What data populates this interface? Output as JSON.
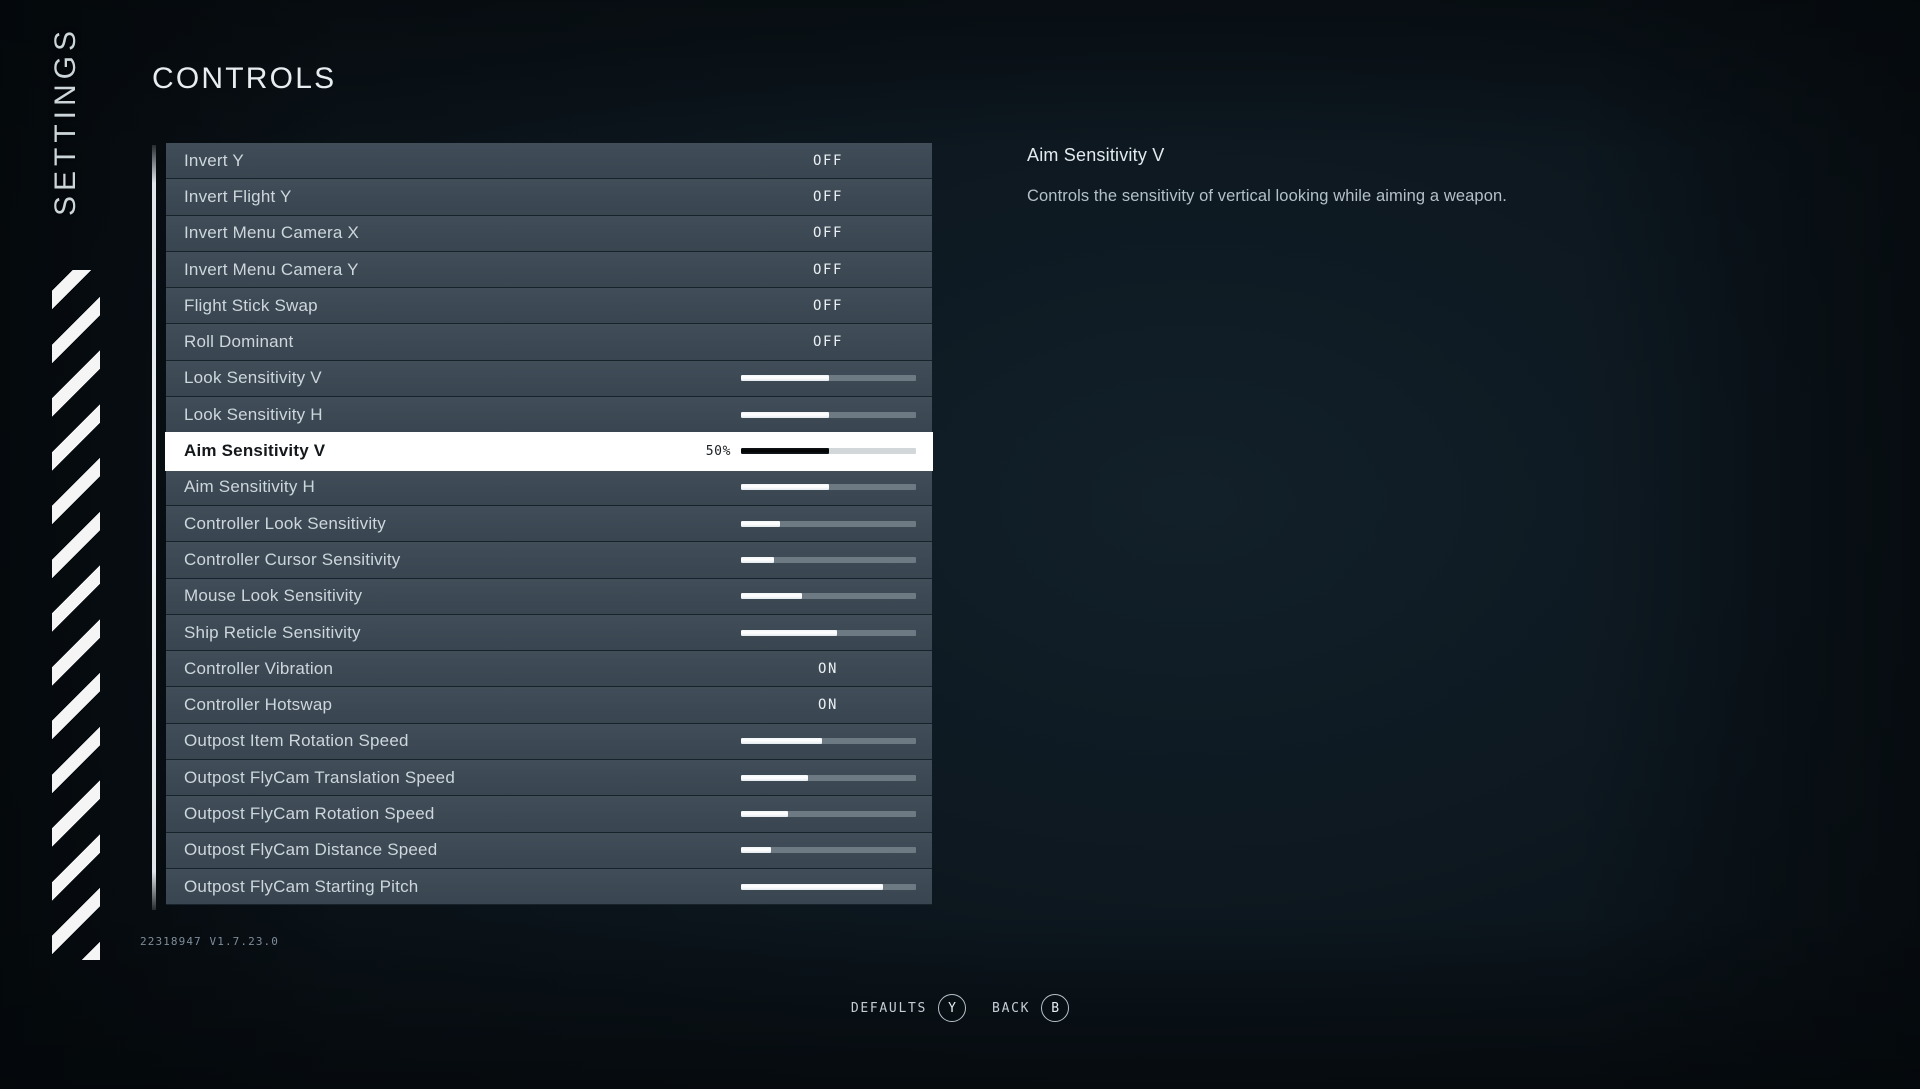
{
  "rail": {
    "title": "SETTINGS",
    "stripes_icon": "diagonal-stripes-decoration"
  },
  "header": {
    "page_title": "CONTROLS"
  },
  "options": [
    {
      "label": "Invert Y",
      "type": "toggle",
      "value": "OFF"
    },
    {
      "label": "Invert Flight Y",
      "type": "toggle",
      "value": "OFF"
    },
    {
      "label": "Invert Menu Camera X",
      "type": "toggle",
      "value": "OFF"
    },
    {
      "label": "Invert Menu Camera Y",
      "type": "toggle",
      "value": "OFF"
    },
    {
      "label": "Flight Stick Swap",
      "type": "toggle",
      "value": "OFF"
    },
    {
      "label": "Roll Dominant",
      "type": "toggle",
      "value": "OFF"
    },
    {
      "label": "Look Sensitivity V",
      "type": "slider",
      "percent": 50
    },
    {
      "label": "Look Sensitivity H",
      "type": "slider",
      "percent": 50
    },
    {
      "label": "Aim Sensitivity V",
      "type": "slider",
      "percent": 50,
      "value": "50%",
      "selected": true
    },
    {
      "label": "Aim Sensitivity H",
      "type": "slider",
      "percent": 50
    },
    {
      "label": "Controller Look Sensitivity",
      "type": "slider",
      "percent": 22
    },
    {
      "label": "Controller Cursor Sensitivity",
      "type": "slider",
      "percent": 19
    },
    {
      "label": "Mouse Look Sensitivity",
      "type": "slider",
      "percent": 35
    },
    {
      "label": "Ship Reticle Sensitivity",
      "type": "slider",
      "percent": 55
    },
    {
      "label": "Controller Vibration",
      "type": "toggle",
      "value": "ON"
    },
    {
      "label": "Controller Hotswap",
      "type": "toggle",
      "value": "ON"
    },
    {
      "label": "Outpost Item Rotation Speed",
      "type": "slider",
      "percent": 46
    },
    {
      "label": "Outpost FlyCam Translation Speed",
      "type": "slider",
      "percent": 38
    },
    {
      "label": "Outpost FlyCam Rotation Speed",
      "type": "slider",
      "percent": 27
    },
    {
      "label": "Outpost FlyCam Distance Speed",
      "type": "slider",
      "percent": 17
    },
    {
      "label": "Outpost FlyCam Starting Pitch",
      "type": "slider",
      "percent": 81
    }
  ],
  "detail": {
    "title": "Aim Sensitivity V",
    "description": "Controls the sensitivity of vertical looking while aiming a weapon."
  },
  "version": "22318947 V1.7.23.0",
  "buttonbar": [
    {
      "label": "DEFAULTS",
      "key": "Y"
    },
    {
      "label": "BACK",
      "key": "B"
    }
  ],
  "colors": {
    "background": "#0d1820",
    "row": "#3c4853",
    "row_text": "#ccd6dc",
    "selected_bg": "#ffffff",
    "selected_text": "#14181b",
    "slider_fill": "#ffffff",
    "slider_track": "#6d7a84",
    "accent": "#e8edf0"
  }
}
